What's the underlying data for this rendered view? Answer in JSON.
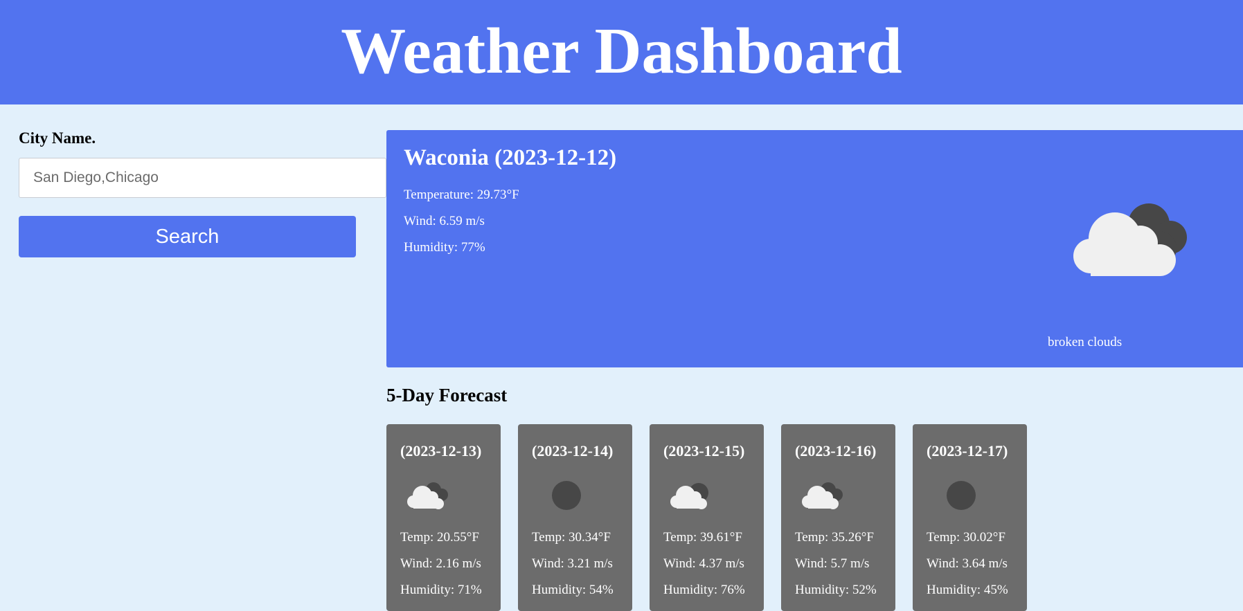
{
  "header": {
    "title": "Weather Dashboard"
  },
  "search": {
    "label": "City Name.",
    "placeholder": "San Diego,Chicago",
    "button_label": "Search"
  },
  "current": {
    "heading": "Waconia (2023-12-12)",
    "temperature": "Temperature: 29.73°F",
    "wind": "Wind: 6.59 m/s",
    "humidity": "Humidity: 77%",
    "description": "broken clouds",
    "icon": "broken-clouds-icon"
  },
  "forecast": {
    "title": "5-Day Forecast",
    "days": [
      {
        "date": "(2023-12-13)",
        "icon": "broken-clouds-icon",
        "temp": "Temp: 20.55°F",
        "wind": "Wind: 2.16 m/s",
        "humidity": "Humidity: 71%"
      },
      {
        "date": "(2023-12-14)",
        "icon": "overcast-icon",
        "temp": "Temp: 30.34°F",
        "wind": "Wind: 3.21 m/s",
        "humidity": "Humidity: 54%"
      },
      {
        "date": "(2023-12-15)",
        "icon": "scattered-clouds-icon",
        "temp": "Temp: 39.61°F",
        "wind": "Wind: 4.37 m/s",
        "humidity": "Humidity: 76%"
      },
      {
        "date": "(2023-12-16)",
        "icon": "broken-clouds-icon",
        "temp": "Temp: 35.26°F",
        "wind": "Wind: 5.7 m/s",
        "humidity": "Humidity: 52%"
      },
      {
        "date": "(2023-12-17)",
        "icon": "overcast-icon",
        "temp": "Temp: 30.02°F",
        "wind": "Wind: 3.64 m/s",
        "humidity": "Humidity: 45%"
      }
    ]
  },
  "colors": {
    "accent": "#5273ef",
    "background": "#e2f0fb",
    "card": "#6c6c6c"
  }
}
